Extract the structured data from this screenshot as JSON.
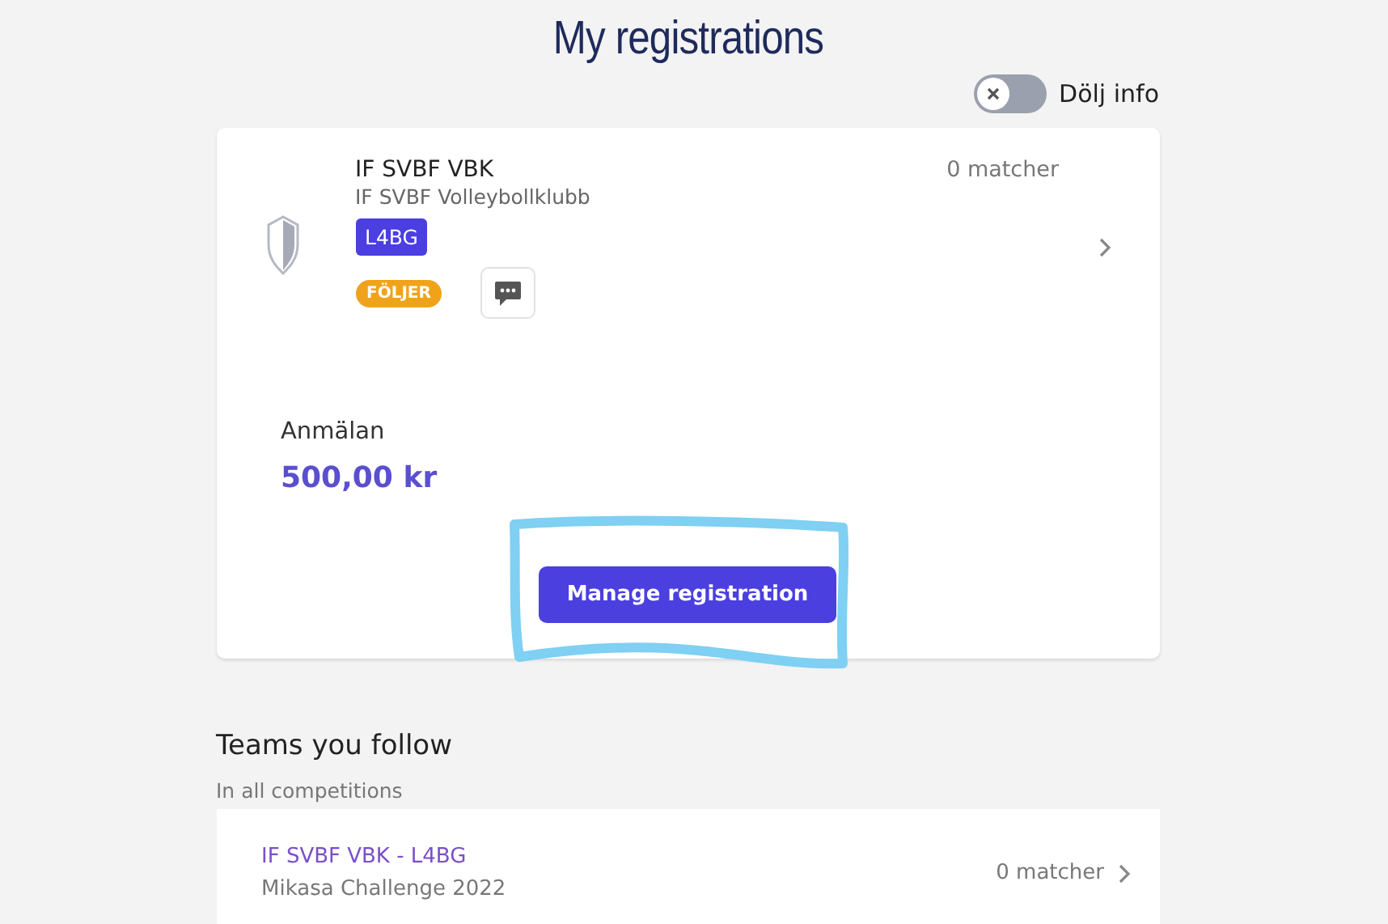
{
  "title": "My registrations",
  "info_toggle": {
    "label": "Dölj info",
    "on": false
  },
  "registration": {
    "name": "IF SVBF VBK",
    "club": "IF SVBF Volleybollklubb",
    "matches": "0 matcher",
    "class_tag": "L4BG",
    "follow_badge": "FÖLJER",
    "fee_label": "Anmälan",
    "fee": "500,00 kr",
    "button": "Manage registration",
    "highlighted": true
  },
  "followed": {
    "heading": "Teams you follow",
    "subtitle": "In all competitions",
    "teams": [
      {
        "name": "IF SVBF VBK - L4BG",
        "competition": "Mikasa Challenge 2022",
        "matches": "0 matcher"
      }
    ]
  }
}
